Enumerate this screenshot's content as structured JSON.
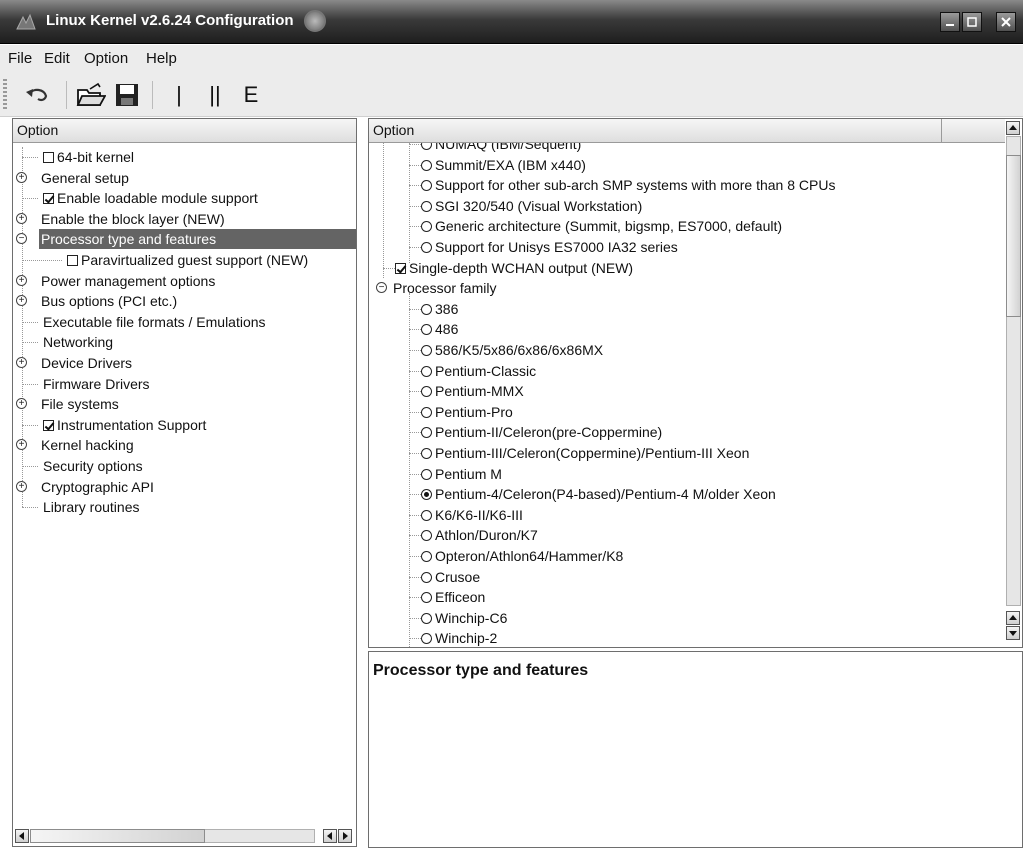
{
  "window": {
    "title": "Linux Kernel v2.6.24 Configuration"
  },
  "menu": [
    "File",
    "Edit",
    "Option",
    "Help"
  ],
  "toolbar": {
    "undo_icon": "undo-icon",
    "open_icon": "open-folder-icon",
    "save_icon": "save-disk-icon",
    "single_view_label": "|",
    "split_view_label": "||",
    "full_view_label": "E"
  },
  "left_pane": {
    "header": "Option",
    "selected": "Processor type and features",
    "items": [
      {
        "label": "64-bit kernel",
        "kind": "checkbox",
        "checked": false,
        "expander": "",
        "indent": 1
      },
      {
        "label": "General setup",
        "kind": "plain",
        "expander": "+",
        "indent": 0
      },
      {
        "label": "Enable loadable module support",
        "kind": "checkbox",
        "checked": true,
        "expander": "",
        "indent": 1
      },
      {
        "label": "Enable the block layer (NEW)",
        "kind": "plain",
        "expander": "+",
        "indent": 0
      },
      {
        "label": "Processor type and features",
        "kind": "plain",
        "expander": "-",
        "indent": 0
      },
      {
        "label": "Paravirtualized guest support (NEW)",
        "kind": "checkbox",
        "checked": false,
        "expander": "",
        "indent": 2
      },
      {
        "label": "Power management options",
        "kind": "plain",
        "expander": "+",
        "indent": 0
      },
      {
        "label": "Bus options (PCI etc.)",
        "kind": "plain",
        "expander": "+",
        "indent": 0
      },
      {
        "label": "Executable file formats / Emulations",
        "kind": "plain",
        "expander": "",
        "indent": 1
      },
      {
        "label": "Networking",
        "kind": "plain",
        "expander": "",
        "indent": 1
      },
      {
        "label": "Device Drivers",
        "kind": "plain",
        "expander": "+",
        "indent": 0
      },
      {
        "label": "Firmware Drivers",
        "kind": "plain",
        "expander": "",
        "indent": 1
      },
      {
        "label": "File systems",
        "kind": "plain",
        "expander": "+",
        "indent": 0
      },
      {
        "label": "Instrumentation Support",
        "kind": "checkbox",
        "checked": true,
        "expander": "",
        "indent": 1
      },
      {
        "label": "Kernel hacking",
        "kind": "plain",
        "expander": "+",
        "indent": 0
      },
      {
        "label": "Security options",
        "kind": "plain",
        "expander": "",
        "indent": 1
      },
      {
        "label": "Cryptographic API",
        "kind": "plain",
        "expander": "+",
        "indent": 0
      },
      {
        "label": "Library routines",
        "kind": "plain",
        "expander": "",
        "indent": 1
      }
    ]
  },
  "right_pane": {
    "header": "Option",
    "items": [
      {
        "label": "NUMAQ (IBM/Sequent)",
        "kind": "radio",
        "checked": false,
        "indent": 2
      },
      {
        "label": "Summit/EXA (IBM x440)",
        "kind": "radio",
        "checked": false,
        "indent": 2
      },
      {
        "label": "Support for other sub-arch SMP systems with more than 8 CPUs",
        "kind": "radio",
        "checked": false,
        "indent": 2
      },
      {
        "label": "SGI 320/540 (Visual Workstation)",
        "kind": "radio",
        "checked": false,
        "indent": 2
      },
      {
        "label": "Generic architecture (Summit, bigsmp, ES7000, default)",
        "kind": "radio",
        "checked": false,
        "indent": 2
      },
      {
        "label": "Support for Unisys ES7000 IA32 series",
        "kind": "radio",
        "checked": false,
        "indent": 2
      },
      {
        "label": "Single-depth WCHAN output (NEW)",
        "kind": "checkbox",
        "checked": true,
        "indent": 1
      },
      {
        "label": "Processor family",
        "kind": "group",
        "checked": false,
        "indent": 0
      },
      {
        "label": "386",
        "kind": "radio",
        "checked": false,
        "indent": 2
      },
      {
        "label": "486",
        "kind": "radio",
        "checked": false,
        "indent": 2
      },
      {
        "label": "586/K5/5x86/6x86/6x86MX",
        "kind": "radio",
        "checked": false,
        "indent": 2
      },
      {
        "label": "Pentium-Classic",
        "kind": "radio",
        "checked": false,
        "indent": 2
      },
      {
        "label": "Pentium-MMX",
        "kind": "radio",
        "checked": false,
        "indent": 2
      },
      {
        "label": "Pentium-Pro",
        "kind": "radio",
        "checked": false,
        "indent": 2
      },
      {
        "label": "Pentium-II/Celeron(pre-Coppermine)",
        "kind": "radio",
        "checked": false,
        "indent": 2
      },
      {
        "label": "Pentium-III/Celeron(Coppermine)/Pentium-III Xeon",
        "kind": "radio",
        "checked": false,
        "indent": 2
      },
      {
        "label": "Pentium M",
        "kind": "radio",
        "checked": false,
        "indent": 2
      },
      {
        "label": "Pentium-4/Celeron(P4-based)/Pentium-4 M/older Xeon",
        "kind": "radio",
        "checked": true,
        "indent": 2
      },
      {
        "label": "K6/K6-II/K6-III",
        "kind": "radio",
        "checked": false,
        "indent": 2
      },
      {
        "label": "Athlon/Duron/K7",
        "kind": "radio",
        "checked": false,
        "indent": 2
      },
      {
        "label": "Opteron/Athlon64/Hammer/K8",
        "kind": "radio",
        "checked": false,
        "indent": 2
      },
      {
        "label": "Crusoe",
        "kind": "radio",
        "checked": false,
        "indent": 2
      },
      {
        "label": "Efficeon",
        "kind": "radio",
        "checked": false,
        "indent": 2
      },
      {
        "label": "Winchip-C6",
        "kind": "radio",
        "checked": false,
        "indent": 2
      },
      {
        "label": "Winchip-2",
        "kind": "radio",
        "checked": false,
        "indent": 2
      }
    ]
  },
  "help_pane": {
    "title": "Processor type and features",
    "body": ""
  },
  "colors": {
    "selection": "#646464",
    "titlebar": "#2a2a2a",
    "background": "#ececec"
  }
}
